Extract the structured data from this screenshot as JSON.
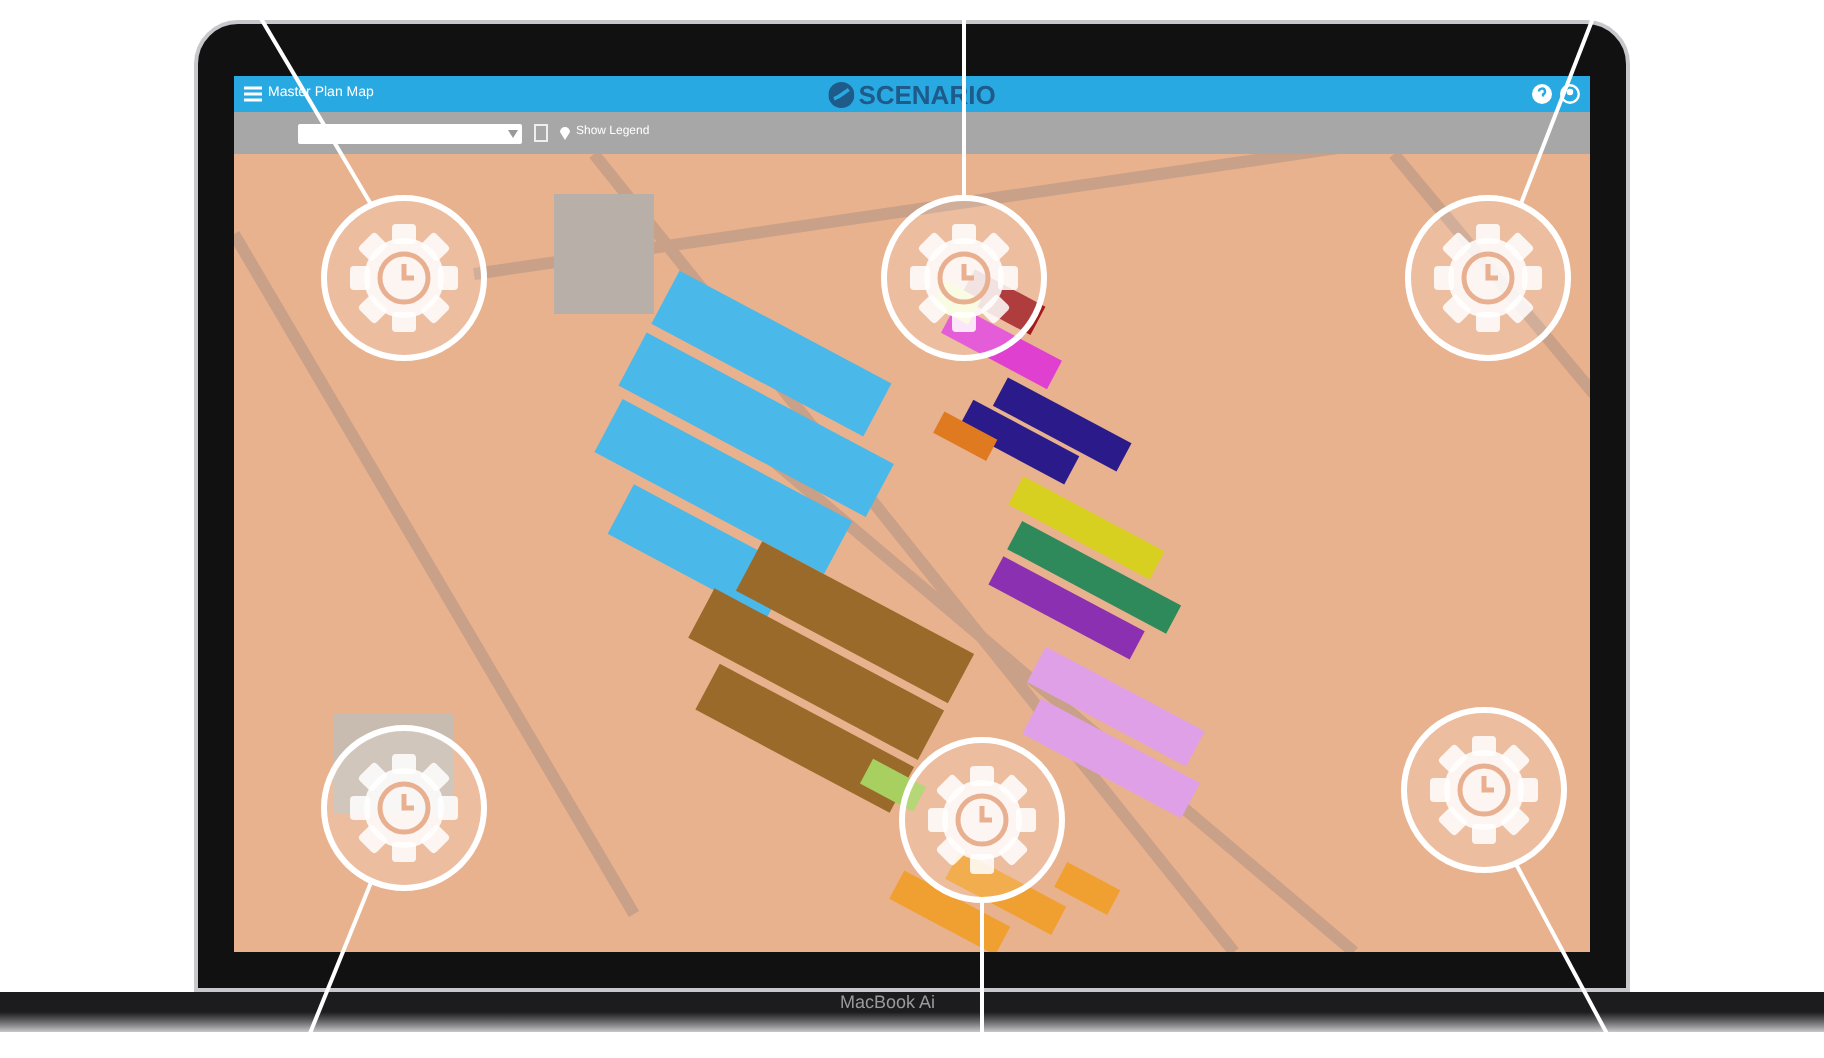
{
  "header": {
    "title": "Master Plan Map",
    "logo": "SCENARIO"
  },
  "toolbar": {
    "legend_button": "Show Legend"
  },
  "laptop": {
    "model_label": "MacBook Ai"
  }
}
